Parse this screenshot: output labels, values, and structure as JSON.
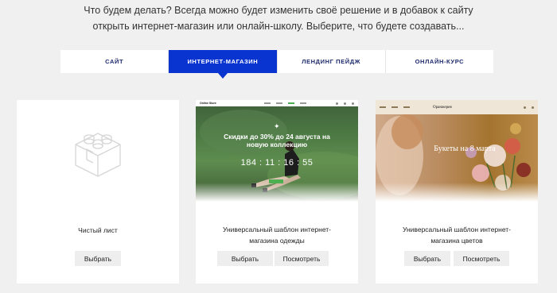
{
  "intro": {
    "line1": "Что будем делать? Всегда можно будет изменить своё решение и в добавок к сайту",
    "line2": "открыть интернет-магазин или онлайн-школу. Выберите, что будете создавать..."
  },
  "tabs": [
    {
      "label": "САЙТ"
    },
    {
      "label": "ИНТЕРНЕТ-МАГАЗИН"
    },
    {
      "label": "ЛЕНДИНГ ПЕЙДЖ"
    },
    {
      "label": "ОНЛАЙН-КУРС"
    }
  ],
  "active_tab": "ИНТЕРНЕТ-МАГАЗИН",
  "cards": [
    {
      "title_line1": "Чистый лист",
      "title_line2": "",
      "select_label": "Выбрать",
      "view_label": ""
    },
    {
      "title_line1": "Универсальный шаблон интернет-",
      "title_line2": "магазина одежды",
      "select_label": "Выбрать",
      "view_label": "Посмотреть",
      "preview": {
        "logo": "Online Store",
        "headline": "Скидки до 30% до 24 августа на новую коллекцию",
        "countdown": "184 : 11 : 16 : 55"
      }
    },
    {
      "title_line1": "Универсальный шаблон интернет-",
      "title_line2": "магазина цветов",
      "select_label": "Выбрать",
      "view_label": "Посмотреть",
      "preview": {
        "logo": "Оранжерея",
        "headline": "Букеты на 8 марта"
      }
    }
  ],
  "colors": {
    "accent": "#0a34d0",
    "background": "#f0f0f0",
    "tab_text": "#1d2a6c"
  }
}
